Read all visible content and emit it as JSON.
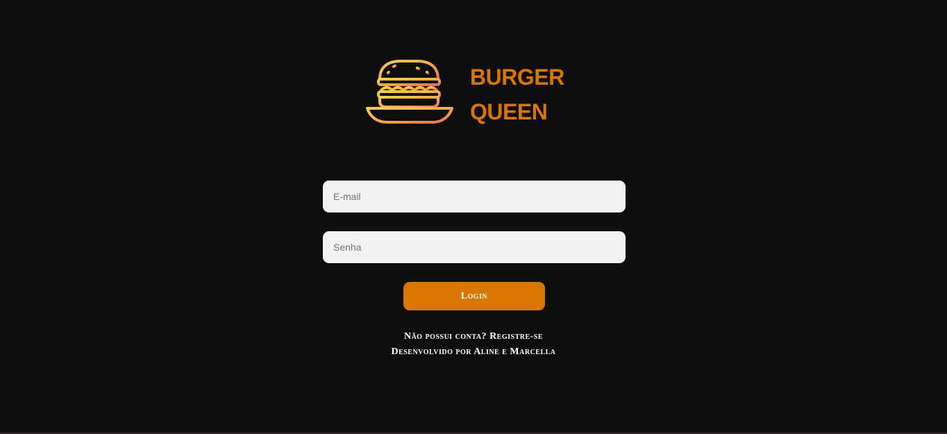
{
  "colors": {
    "background": "#0e0e0e",
    "brand_orange": "#d97600",
    "logo_gradient_start": "#fcd04b",
    "logo_gradient_end": "#f26b5b",
    "input_background": "#f1f1f1",
    "footer_strip": "#3a2a2a"
  },
  "logo": {
    "icon": "burger-icon",
    "line1": "BURGER",
    "line2": "QUEEN"
  },
  "form": {
    "email_placeholder": "E-mail",
    "email_value": "",
    "password_placeholder": "Senha",
    "password_value": "",
    "login_label": "Login"
  },
  "footer": {
    "register_prompt": "Não possui conta?",
    "register_link": "Registre-se",
    "credits": "Desenvolvido por Aline e Marcella"
  }
}
